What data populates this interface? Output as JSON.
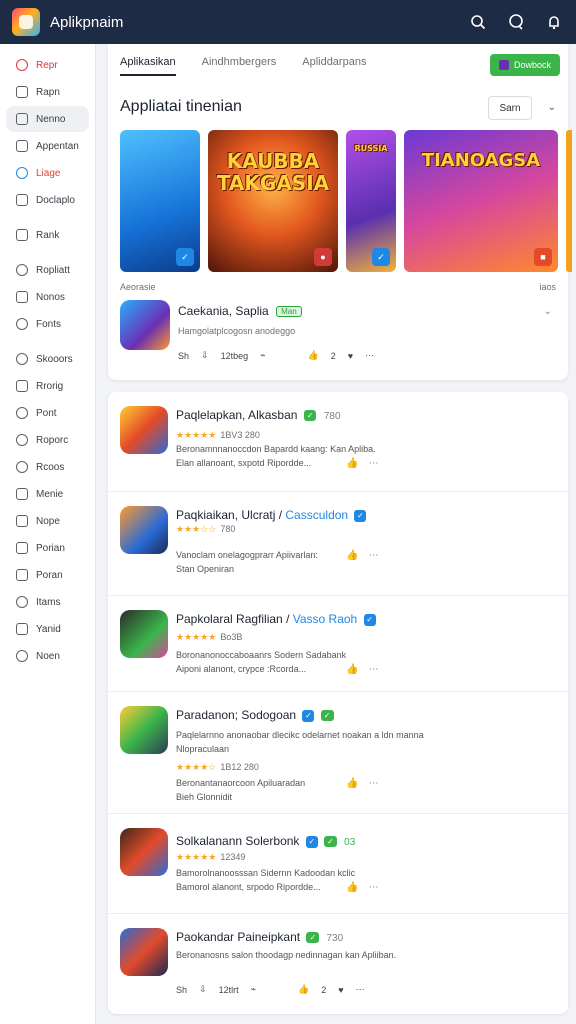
{
  "header": {
    "title": "Aplikpnaim",
    "colors": {
      "bar": "#1e2b44"
    },
    "icons": [
      "search-icon",
      "chat-icon",
      "notification-icon"
    ]
  },
  "sidebar": {
    "items": [
      {
        "label": "Repr",
        "icon": "flame-icon"
      },
      {
        "label": "Rapn",
        "icon": "chat-icon"
      },
      {
        "label": "Nenno",
        "icon": "grid-icon"
      },
      {
        "label": "Appentan",
        "icon": "bag-icon"
      },
      {
        "label": "Liage",
        "icon": "sync-icon"
      },
      {
        "label": "Doclaplo",
        "icon": "doc-icon"
      },
      {
        "label": "Rank",
        "icon": "square-icon"
      },
      {
        "label": "Ropliatt",
        "icon": "search-icon"
      },
      {
        "label": "Nonos",
        "icon": "pen-icon"
      },
      {
        "label": "Fonts",
        "icon": "circle-icon"
      },
      {
        "label": "Skooors",
        "icon": "chat-icon"
      },
      {
        "label": "Rrorig",
        "icon": "chart-icon"
      },
      {
        "label": "Pont",
        "icon": "clock-icon"
      },
      {
        "label": "Roporc",
        "icon": "clock-icon"
      },
      {
        "label": "Rcoos",
        "icon": "user-icon"
      },
      {
        "label": "Menie",
        "icon": "doc-icon"
      },
      {
        "label": "Nope",
        "icon": "pen-icon"
      },
      {
        "label": "Porian",
        "icon": "doc-icon"
      },
      {
        "label": "Poran",
        "icon": "send-icon"
      },
      {
        "label": "Itams",
        "icon": "circle-icon"
      },
      {
        "label": "Yanid",
        "icon": "doc-icon"
      },
      {
        "label": "Noen",
        "icon": "clock-icon"
      }
    ]
  },
  "main": {
    "tabs": [
      "Aplikasikan",
      "Aindhmbergers",
      "Apliddarpans"
    ],
    "download_label": "Dowbock",
    "section_title": "Appliatai tinenian",
    "sort_label": "Sarn",
    "banners": [
      {
        "text": "",
        "accent": "#1f88e5"
      },
      {
        "text": "KAUBBA TAKGASIA",
        "accent": "#d23a3a"
      },
      {
        "text": "RUSSIA",
        "accent": "#1f88e5"
      },
      {
        "text": "TIANOAGSA",
        "accent": "#e24a2a"
      }
    ],
    "featured_label": "Aeorasie",
    "featured_count": "iaos",
    "featured": {
      "name": "Caekania, Saplia",
      "tag": "Man",
      "desc": "Hamgolatplcogosn anodeggo",
      "meta_left": "Sh",
      "meta_count": "12tbeg",
      "meta_right": "2"
    },
    "apps": [
      {
        "name": "Paqlelapkan, Alkasban",
        "badge": "",
        "extra": "780",
        "rating_stars": "★★★★★",
        "rating_text": "1BV3 280",
        "lines": [
          "Beronamnnanoccdon Bapardd kaang: Kan Apliba.",
          "Elan allanoant, sxpotd Ripordde..."
        ]
      },
      {
        "name": "Paqkiaikan, Ulcratj /",
        "link": "Cassculdon",
        "extra": "",
        "rating_stars": "★★★☆☆",
        "rating_text": "780",
        "lines": [
          "Vanoclam onelagogprarr Apiivarlan:",
          "Stan Openiran"
        ]
      },
      {
        "name": "Papkolaral Ragfilian /",
        "link": "Vasso Raoh",
        "extra": "",
        "rating_stars": "★★★★★",
        "rating_text": "Bo3B",
        "lines": [
          "Boronanonoccaboaanrs Sodern Sadabank",
          "Aiponi alanont, crypce :Rcorda..."
        ]
      },
      {
        "name": "Paradanon; Sodogoan",
        "extra": "",
        "rating_stars": "★★★★☆",
        "rating_text": "1B12 280",
        "lines": [
          "Paqlelarnno anonaobar dlecikc odelarnet noakan a ldn manna",
          "Nlopraculaan",
          "Beronantanaorcoon Apiluaradan",
          "Bieh Glonnidit"
        ]
      },
      {
        "name": "Solkalanann Solerbonk",
        "extra": "03",
        "rating_stars": "★★★★★",
        "rating_text": "12349",
        "lines": [
          "Bamorolnanoosssan Sidernn Kadoodan kclic",
          "Bamorol alanont, srpodo Ripordde..."
        ]
      },
      {
        "name": "Paokandar Paineipkant",
        "extra": "730",
        "rating_stars": "",
        "rating_text": "",
        "lines": [
          "Beronanosns salon thoodagp nedinnagan kan Apliiban."
        ],
        "meta_left": "Sh",
        "meta_count": "12tlrt",
        "meta_right": "2"
      }
    ]
  }
}
